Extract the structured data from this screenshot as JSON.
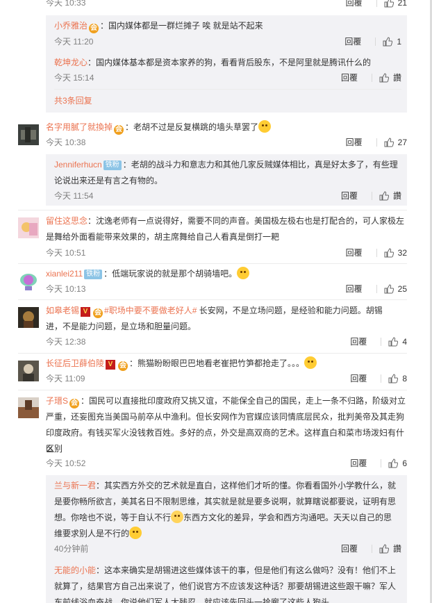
{
  "comments": [
    {
      "time": "今天 10:33",
      "reply": "回覆",
      "likes": "21"
    },
    {
      "user": "名字用膩了就換掉",
      "text": "：老胡不过是反复横跳的墙头草罢了",
      "time": "今天 10:38",
      "reply": "回覆",
      "likes": "27"
    },
    {
      "user": "留住这思念",
      "text_l1": "：沈逸老师有一点说得好，需要不同的声音。美国极左极右也是打配合的，可人家极左",
      "text_l2": "是舞给外面看能带来效果的，胡主席舞给自己人看真是倒打一耙",
      "time": "今天 10:51",
      "reply": "回覆",
      "likes": "32"
    },
    {
      "user": "xianlei211",
      "fan_badge": "铁粉",
      "text": "：低端玩家说的就是那个胡骑墙吧。",
      "time": "今天 10:13",
      "reply": "回覆",
      "likes": "25"
    },
    {
      "user": "如皋老锡",
      "topic": "#职场中要不要做老好人#",
      "text_l1": " 长安网，不是立场问题，是经验和能力问题。胡锡",
      "text_l2": "进，不是能力问题，是立场和胆量问题。",
      "time": "今天 12:38",
      "reply": "回覆",
      "likes": "4"
    },
    {
      "user": "长征后卫薛伯陵",
      "text": "：熊猫盼盼眼巴巴地看老崔把竹笋都抢走了。。。",
      "time": "今天 11:09",
      "reply": "回覆",
      "likes": "8"
    },
    {
      "user": "子瑨S",
      "text_l1": "：国民可以直接批印度政府又挑又谊，不能保全自己的国民，走上一条不归路，阶级对立",
      "text_l2": "严重，还妄图充当美国马前卒从中渔利。但长安网作为官媒应该同情底层民众，批判美帝及其走狗",
      "text_l3": "印度政府。有钱买军火没钱救百姓。多好的点，外交是高双商的艺术。这样直白和菜市场泼妇有什么",
      "text_l4": "区别",
      "time": "今天 10:52",
      "reply": "回覆",
      "likes": "6"
    }
  ],
  "replies": [
    {
      "user": "小乔雅治",
      "text": "：国内媒体都是一群烂摊子 唉 就是站不起来",
      "time": "今天 11:20",
      "reply": "回覆",
      "likes": "1"
    },
    {
      "user": "乾坤龙心",
      "text": "：国内媒体基本都是资本家养的狗，看看背后股东，不是阿里就是腾讯什么的",
      "time": "今天 15:14",
      "reply": "回覆",
      "likes": "讚"
    },
    {
      "user": "Jenniferhucn",
      "fan_badge": "铁粉",
      "text_l1": "：老胡的战斗力和意志力和其他几家反贼媒体相比，真是好太多了，有些理",
      "text_l2": "论说出来还是有言之有物的。",
      "time": "今天 11:54",
      "reply": "回覆",
      "likes": "讚"
    },
    {
      "user": "兰与新一君",
      "text_l1": "：其实西方外交的艺术就是直白，这样他们才听的懂。你看看国外小学教什么，就",
      "text_l2": "是要你畅所欲言，美其名日不限制思维，其实就是就是要多说啊，就算瞎说都要说，证明有思",
      "text_l3a": "想。你啥也不说，等于自认不行",
      "text_l3b": "东西方文化的差异，学会和西方沟通吧。天天以自己的思",
      "text_l4": "维要求别人是不行的",
      "time": "40分钟前",
      "reply": "回覆",
      "likes": "讚"
    },
    {
      "user": "无能的小能",
      "text_l1": "：这本来确实是胡锡进这些媒体该干的事，但是他们有这么做吗？没有！他们不上",
      "text_l2": "就算了，结果官方自己出来说了，他们说官方不应该发这种话？那要胡锡进这些跟干嘛？军人",
      "text_l3": "东前线浴血奋战，你说他们军人太残忍，就应该先回头一拾廊了这些人狗头"
    }
  ],
  "more_replies": "共3条回复",
  "colors": {
    "username": "#eb7350",
    "sub_bg": "#f2f2f5",
    "text": "#333333",
    "muted": "#808080"
  },
  "icons": [
    "thumbs-up-icon",
    "member-crown-icon",
    "verified-v-icon",
    "smile-emoji-icon",
    "cry-emoji-icon",
    "hug-emoji-icon"
  ]
}
